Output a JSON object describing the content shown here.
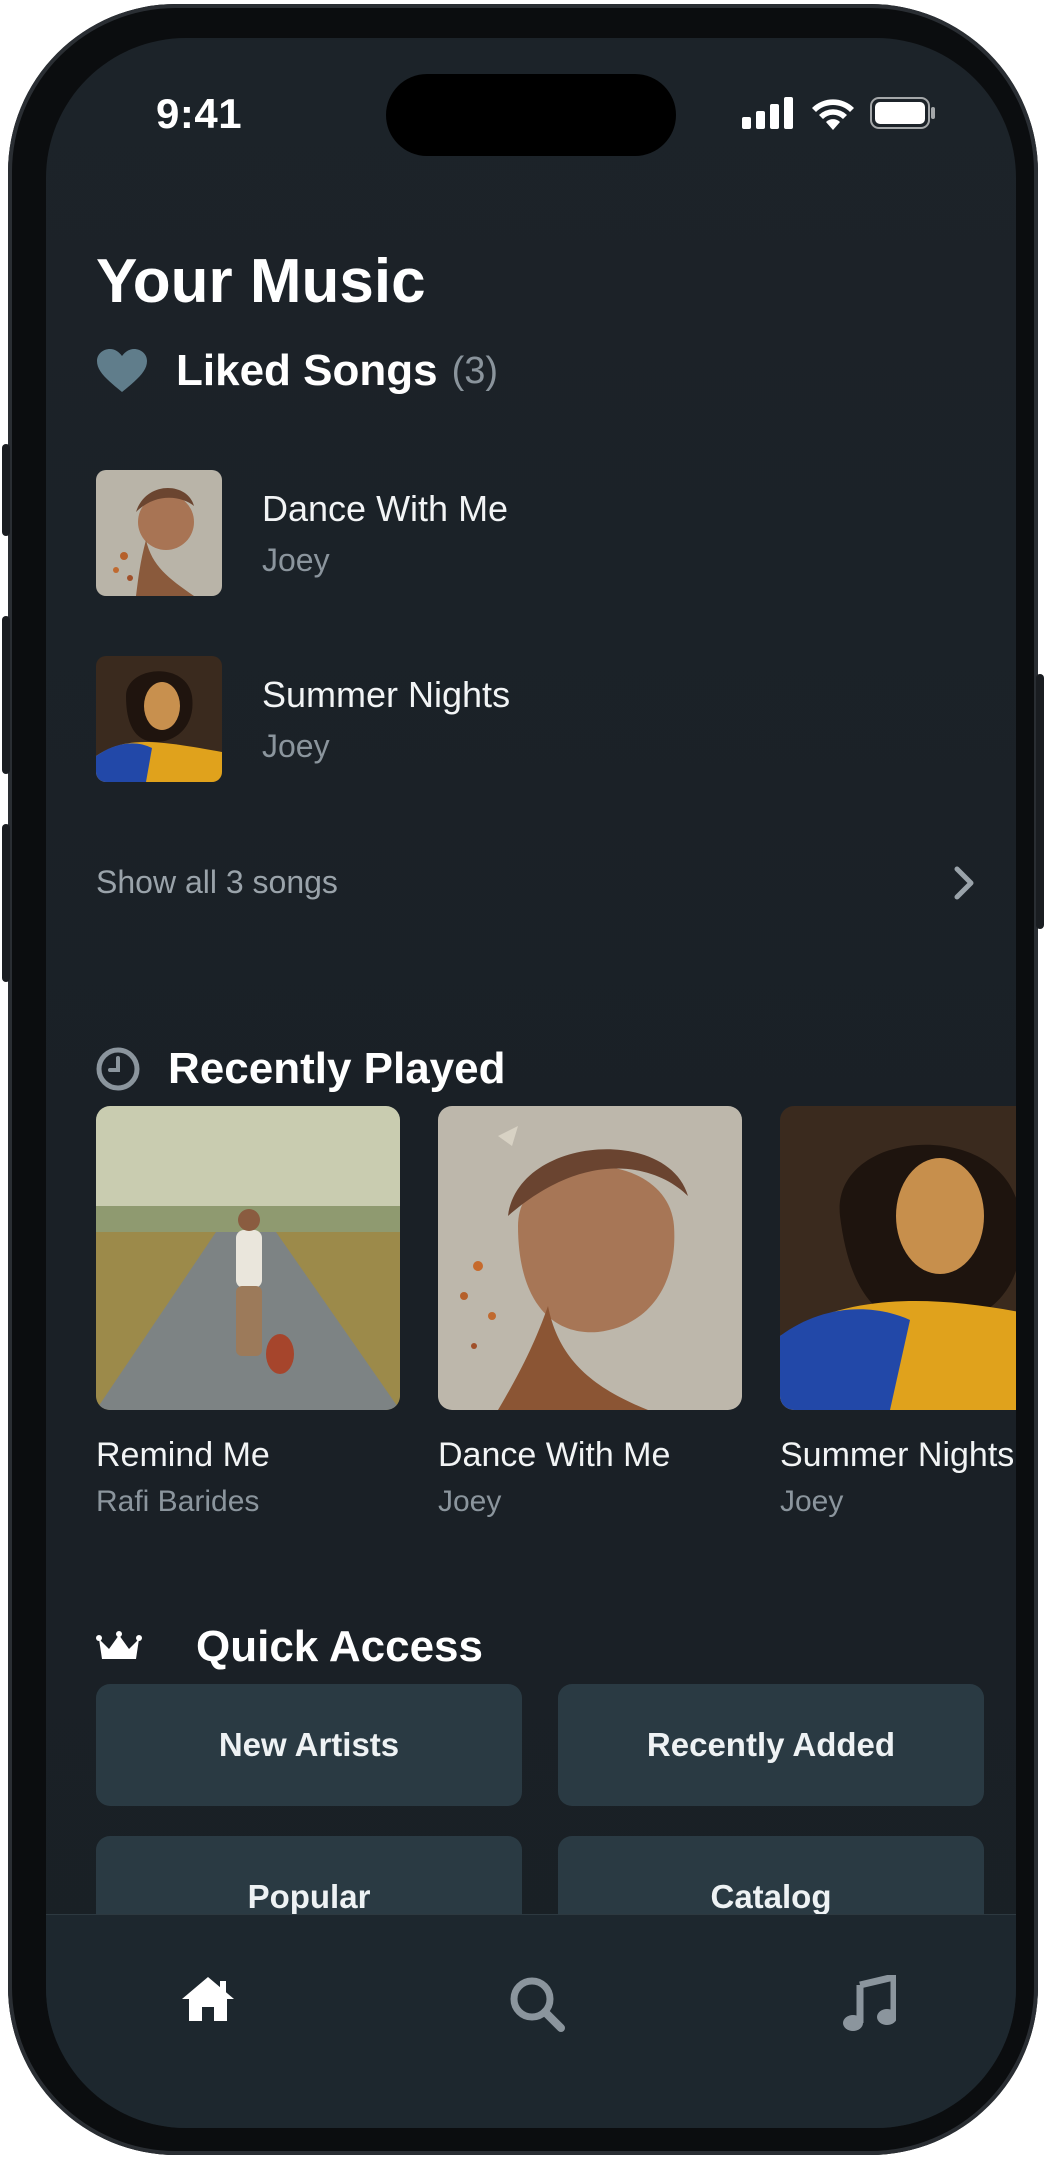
{
  "status_bar": {
    "time": "9:41"
  },
  "page_title": "Your Music",
  "liked_songs": {
    "title": "Liked Songs",
    "count": "(3)",
    "items": [
      {
        "title": "Dance With Me",
        "artist": "Joey"
      },
      {
        "title": "Summer Nights",
        "artist": "Joey"
      }
    ],
    "show_all_label": "Show all 3 songs"
  },
  "recently_played": {
    "title": "Recently Played",
    "items": [
      {
        "title": "Remind Me",
        "artist": "Rafi Barides"
      },
      {
        "title": "Dance With Me",
        "artist": "Joey"
      },
      {
        "title": "Summer Nights",
        "artist": "Joey"
      }
    ]
  },
  "quick_access": {
    "title": "Quick Access",
    "buttons": [
      "New Artists",
      "Recently Added",
      "Popular",
      "Catalog"
    ]
  },
  "tab_bar": {
    "icons": [
      "home-icon",
      "search-icon",
      "music-note-icon"
    ],
    "active": "home"
  },
  "colors": {
    "background": "#1a2026",
    "card": "#2a3a43",
    "muted_text": "#8b959d",
    "accent_icon": "#607d8b"
  }
}
